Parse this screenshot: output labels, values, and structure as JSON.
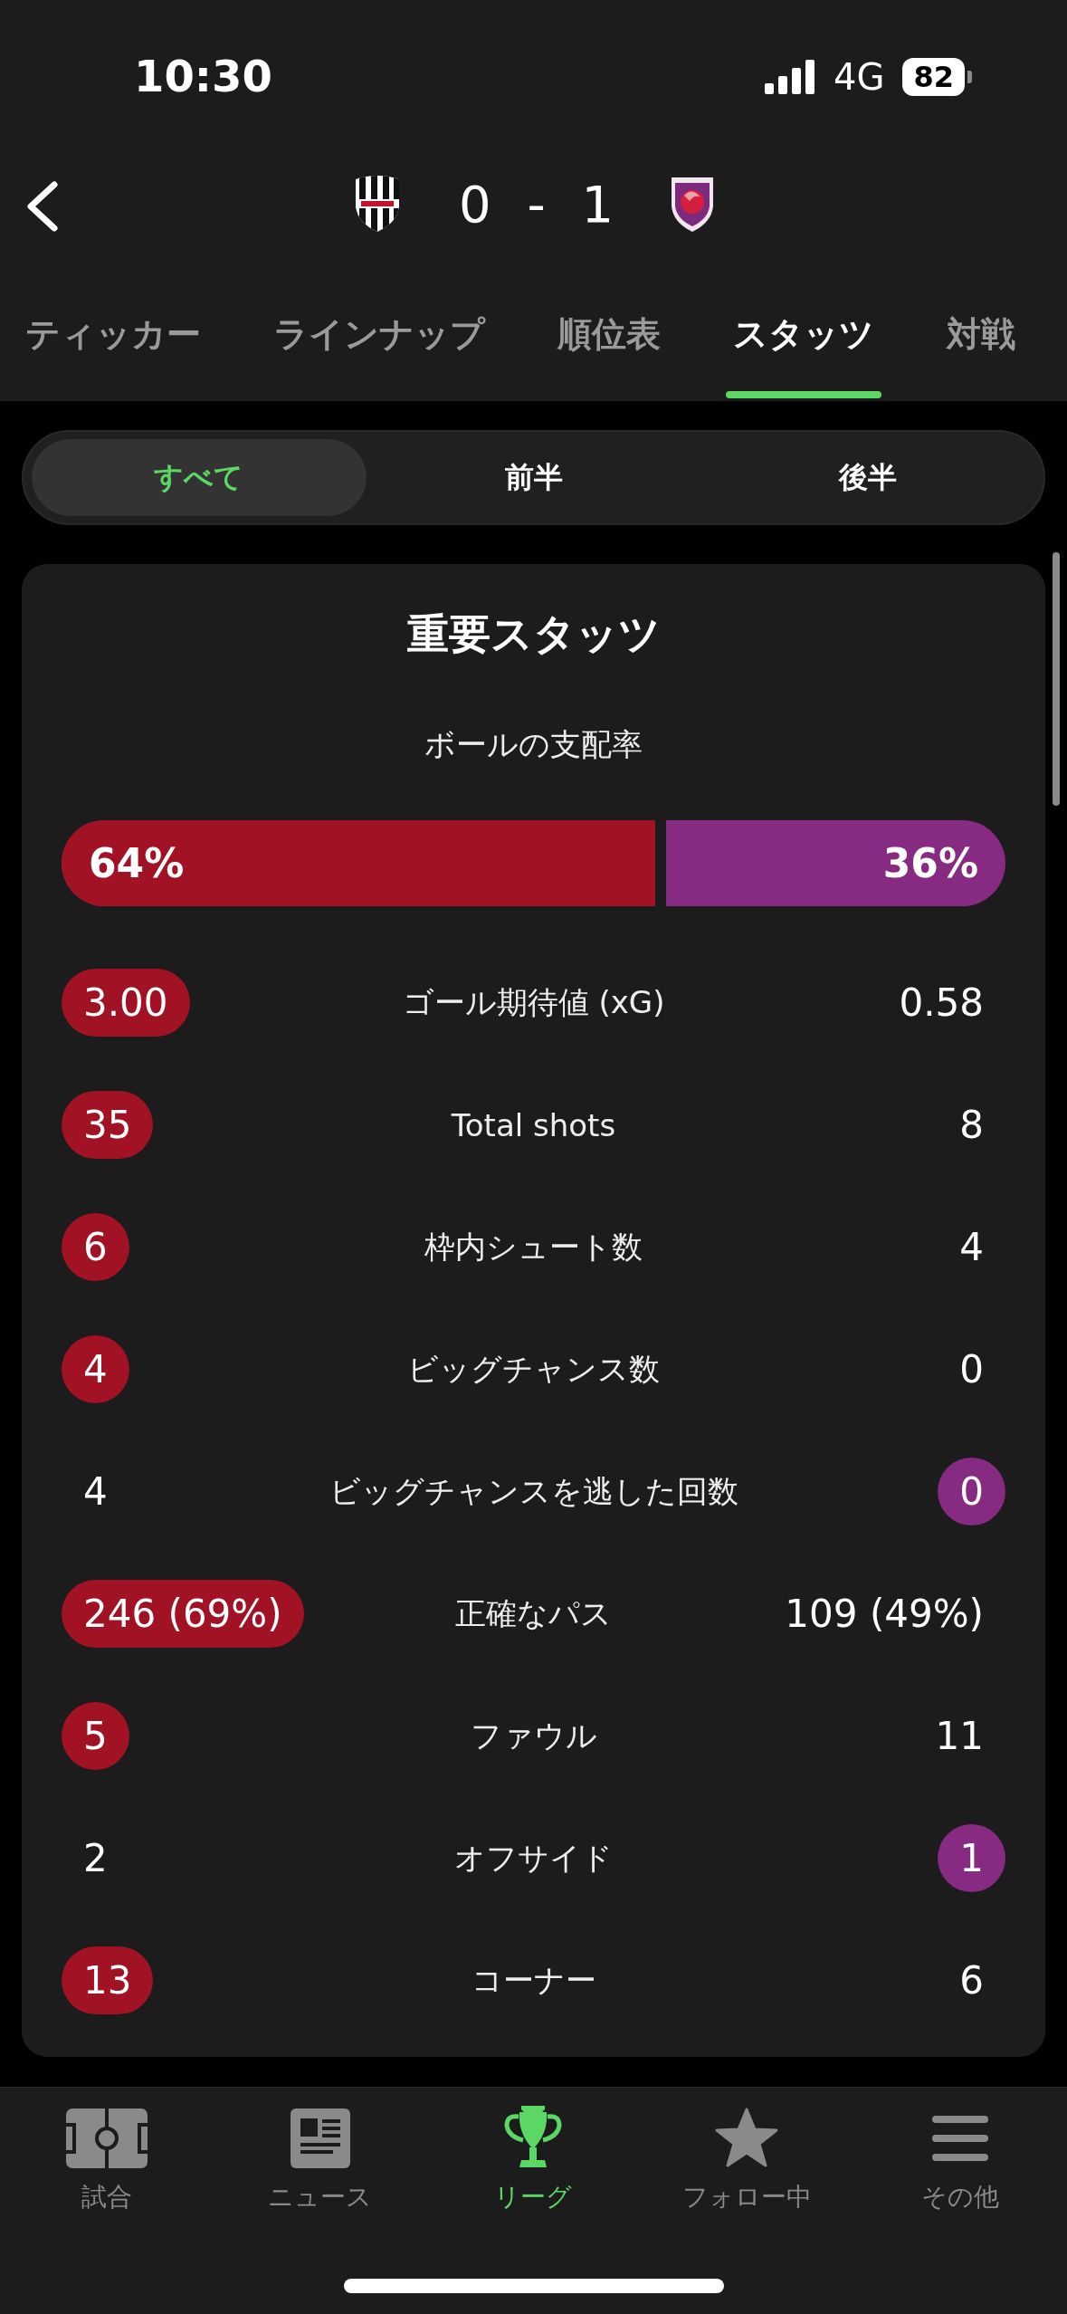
{
  "status_bar": {
    "time": "10:30",
    "network": "4G",
    "battery": "82"
  },
  "header": {
    "score": "0 - 1"
  },
  "tabs": [
    {
      "label": "ティッカー",
      "selected": false
    },
    {
      "label": "ラインナップ",
      "selected": false
    },
    {
      "label": "順位表",
      "selected": false
    },
    {
      "label": "スタッツ",
      "selected": true
    },
    {
      "label": "対戦",
      "selected": false
    }
  ],
  "period_filter": [
    {
      "label": "すべて",
      "selected": true
    },
    {
      "label": "前半",
      "selected": false
    },
    {
      "label": "後半",
      "selected": false
    }
  ],
  "key_stats": {
    "title": "重要スタッツ",
    "possession": {
      "label": "ボールの支配率",
      "home": "64%",
      "away": "36%",
      "level": 0.64
    },
    "rows": [
      {
        "label": "ゴール期待値 (xG)",
        "home": "3.00",
        "away": "0.58",
        "home_leads": true,
        "away_leads": false
      },
      {
        "label": "Total shots",
        "home": "35",
        "away": "8",
        "home_leads": true,
        "away_leads": false
      },
      {
        "label": "枠内シュート数",
        "home": "6",
        "away": "4",
        "home_leads": true,
        "away_leads": false
      },
      {
        "label": "ビッグチャンス数",
        "home": "4",
        "away": "0",
        "home_leads": true,
        "away_leads": false
      },
      {
        "label": "ビッグチャンスを逃した回数",
        "home": "4",
        "away": "0",
        "home_leads": false,
        "away_leads": true
      },
      {
        "label": "正確なパス",
        "home": "246 (69%)",
        "away": "109 (49%)",
        "home_leads": true,
        "away_leads": false
      },
      {
        "label": "ファウル",
        "home": "5",
        "away": "11",
        "home_leads": true,
        "away_leads": false
      },
      {
        "label": "オフサイド",
        "home": "2",
        "away": "1",
        "home_leads": false,
        "away_leads": true
      },
      {
        "label": "コーナー",
        "home": "13",
        "away": "6",
        "home_leads": true,
        "away_leads": false
      }
    ]
  },
  "bottom_nav": [
    {
      "label": "試合",
      "kind": "pitch",
      "selected": false
    },
    {
      "label": "ニュース",
      "kind": "news",
      "selected": false
    },
    {
      "label": "リーグ",
      "kind": "trophy",
      "selected": true
    },
    {
      "label": "フォロー中",
      "kind": "star",
      "selected": false
    },
    {
      "label": "その他",
      "kind": "menu",
      "selected": false
    }
  ]
}
